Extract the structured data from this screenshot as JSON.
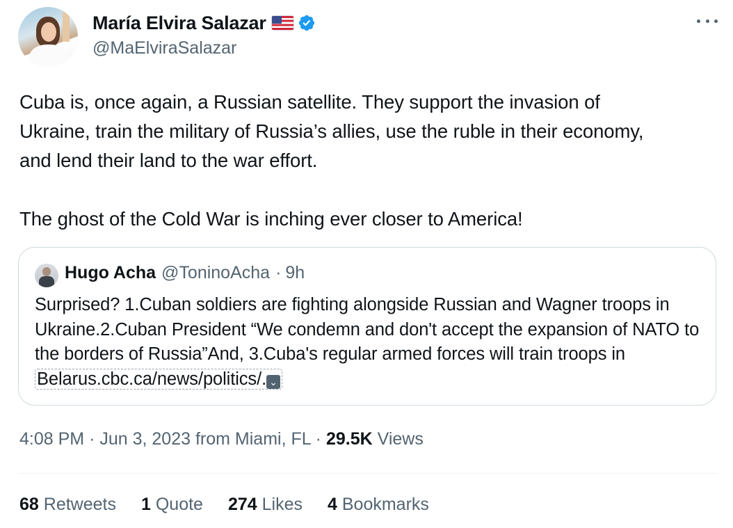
{
  "author": {
    "name": "María Elvira Salazar",
    "handle": "@MaElviraSalazar"
  },
  "tweet": {
    "text": "Cuba is, once again, a Russian satellite. They support the invasion of\nUkraine, train the military of Russia’s allies, use the ruble in their economy,\nand lend their land to the war effort.\n\nThe ghost of the Cold War is inching ever closer to America!"
  },
  "quote": {
    "name": "Hugo Acha",
    "handle": "@ToninoAcha",
    "separator": "·",
    "time": "9h",
    "text_before_link": "Surprised? 1.Cuban soldiers are fighting alongside Russian and Wagner troops in Ukraine.2.Cuban President “We condemn and don't accept the expansion of NATO to the borders of Russia”And, 3.Cuba's regular armed forces will train troops in ",
    "link_text": "Belarus.cbc.ca/news/politics/."
  },
  "meta": {
    "time": "4:08 PM",
    "date": "Jun 3, 2023",
    "location": "from Miami, FL",
    "views_count": "29.5K",
    "views_label": "Views"
  },
  "stats": [
    {
      "count": "68",
      "label": "Retweets"
    },
    {
      "count": "1",
      "label": "Quote"
    },
    {
      "count": "274",
      "label": "Likes"
    },
    {
      "count": "4",
      "label": "Bookmarks"
    }
  ],
  "colors": {
    "verified": "#1d9bf0",
    "secondary_text": "#536471",
    "border": "#cfd9de"
  }
}
